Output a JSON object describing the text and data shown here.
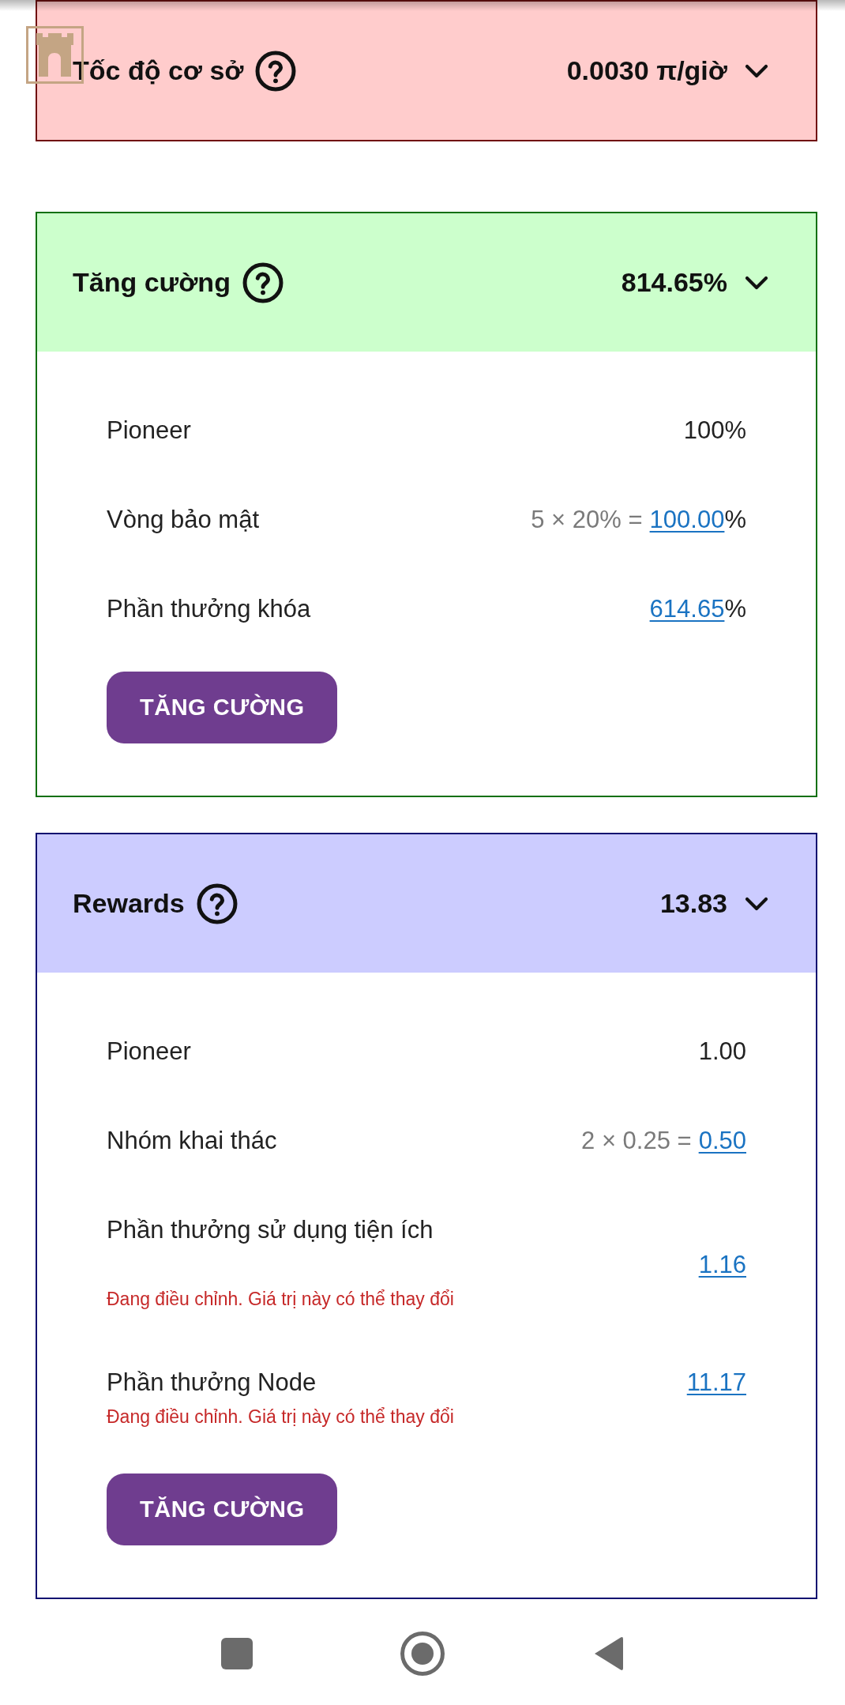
{
  "sections": [
    {
      "title": "Tốc độ cơ sở",
      "total": "0.0030 π/giờ",
      "color": "#ffcccc",
      "expanded": false
    },
    {
      "title": "Tăng cường",
      "total": "814.65%",
      "color": "#ccffcc",
      "expanded": true,
      "rows": [
        {
          "kind": "inline",
          "label": "Pioneer",
          "value": "100%",
          "linked": false
        },
        {
          "kind": "inline",
          "label": "Vòng bảo mật",
          "formula": "5 × 20% =",
          "value": "100.00",
          "linked": true,
          "unit": "%"
        },
        {
          "kind": "inline",
          "label": "Phần thưởng khóa",
          "value": "614.65",
          "linked": true,
          "unit": "%"
        }
      ],
      "button": "TĂNG CƯỜNG"
    },
    {
      "title": "Rewards",
      "total": "13.83",
      "color": "#ccccff",
      "expanded": true,
      "rows": [
        {
          "kind": "inline",
          "label": "Pioneer",
          "value": "1.00",
          "linked": false
        },
        {
          "kind": "inline",
          "label": "Nhóm khai thác",
          "formula": "2 × 0.25 =",
          "value": "0.50",
          "linked": true
        },
        {
          "kind": "wrapped",
          "label": "Phần thưởng sử dụng tiện ích",
          "value": "1.16",
          "linked": true,
          "note": "Đang điều chỉnh. Giá trị này có thể thay đổi"
        },
        {
          "kind": "inline",
          "label": "Phần thưởng Node",
          "value": "11.17",
          "linked": true,
          "note": "Đang điều chỉnh. Giá trị này có thể thay đổi"
        }
      ],
      "button": "TĂNG CƯỜNG"
    }
  ]
}
